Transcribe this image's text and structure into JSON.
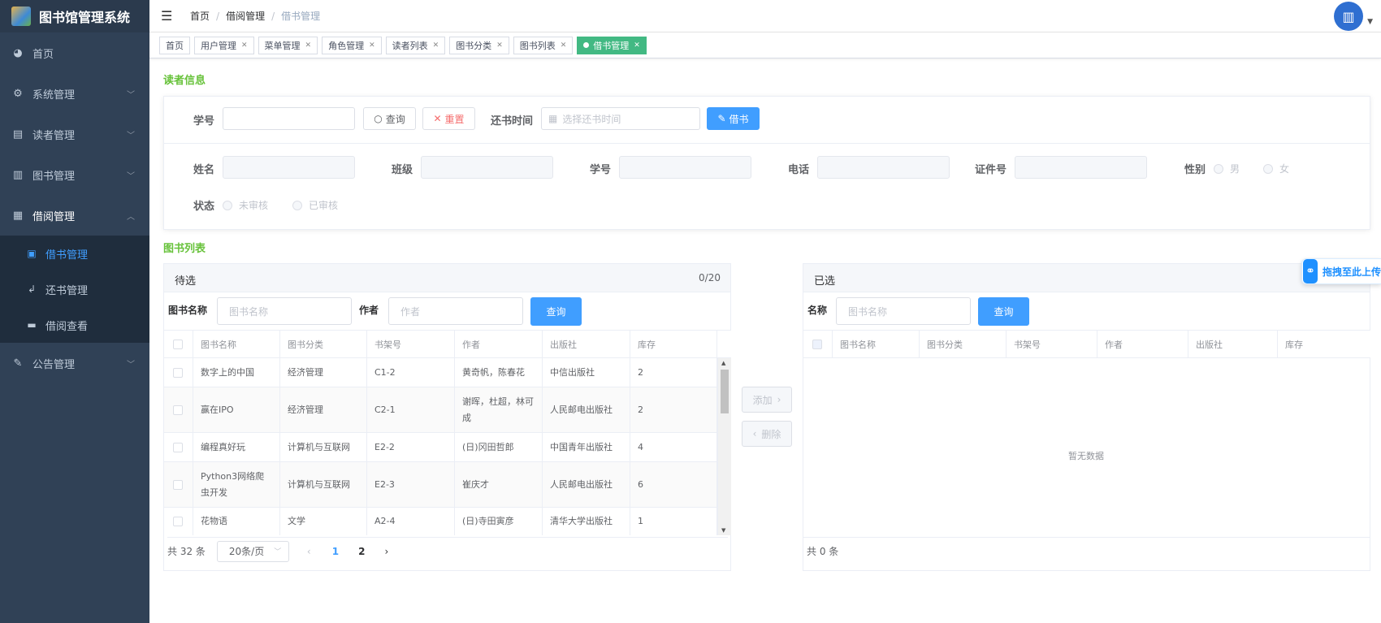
{
  "app": {
    "title": "图书馆管理系统"
  },
  "sidebar": {
    "items": [
      {
        "label": "首页",
        "icon": "dashboard-icon",
        "glyph": "◕"
      },
      {
        "label": "系统管理",
        "icon": "gear-icon",
        "glyph": "⚙"
      },
      {
        "label": "读者管理",
        "icon": "id-card-icon",
        "glyph": "▤"
      },
      {
        "label": "图书管理",
        "icon": "books-icon",
        "glyph": "▥"
      },
      {
        "label": "借阅管理",
        "icon": "document-icon",
        "glyph": "▦"
      },
      {
        "label": "公告管理",
        "icon": "megaphone-icon",
        "glyph": "✎"
      }
    ],
    "sub": [
      {
        "label": "借书管理",
        "icon": "book-icon",
        "glyph": "▣"
      },
      {
        "label": "还书管理",
        "icon": "return-icon",
        "glyph": "↲"
      },
      {
        "label": "借阅查看",
        "icon": "briefcase-icon",
        "glyph": "▬"
      }
    ]
  },
  "header": {
    "breadcrumb": [
      "首页",
      "借阅管理",
      "借书管理"
    ],
    "separator": "/"
  },
  "tags": [
    "首页",
    "用户管理",
    "菜单管理",
    "角色管理",
    "读者列表",
    "图书分类",
    "图书列表",
    "借书管理"
  ],
  "reader": {
    "title": "读者信息",
    "student_no_label": "学号",
    "query_label": "查询",
    "reset_label": "重置",
    "return_time_label": "还书时间",
    "return_time_placeholder": "选择还书时间",
    "borrow_label": "借书",
    "name_label": "姓名",
    "class_label": "班级",
    "student_no2_label": "学号",
    "phone_label": "电话",
    "id_label": "证件号",
    "gender_label": "性别",
    "male": "男",
    "female": "女",
    "status_label": "状态",
    "unreviewed": "未审核",
    "reviewed": "已审核"
  },
  "books": {
    "title": "图书列表",
    "left": {
      "title": "待选",
      "count": "0/20",
      "name_label": "图书名称",
      "name_placeholder": "图书名称",
      "author_label": "作者",
      "author_placeholder": "作者",
      "query_label": "查询",
      "columns": [
        "图书名称",
        "图书分类",
        "书架号",
        "作者",
        "出版社",
        "库存"
      ],
      "rows": [
        [
          "数字上的中国",
          "经济管理",
          "C1-2",
          "黄奇帆，陈春花",
          "中信出版社",
          "2"
        ],
        [
          "赢在IPO",
          "经济管理",
          "C2-1",
          "谢晖，杜超，林可成",
          "人民邮电出版社",
          "2"
        ],
        [
          "编程真好玩",
          "计算机与互联网",
          "E2-2",
          "(日)冈田哲郎",
          "中国青年出版社",
          "4"
        ],
        [
          "Python3网络爬虫开发",
          "计算机与互联网",
          "E2-3",
          "崔庆才",
          "人民邮电出版社",
          "6"
        ],
        [
          "花物语",
          "文学",
          "A2-4",
          "(日)寺田寅彦",
          "清华大学出版社",
          "1"
        ]
      ],
      "total": "共 32 条",
      "page_size": "20条/页",
      "pages": [
        "1",
        "2"
      ]
    },
    "add_label": "添加",
    "remove_label": "删除",
    "right": {
      "title": "已选",
      "name_label": "名称",
      "name_placeholder": "图书名称",
      "query_label": "查询",
      "columns": [
        "图书名称",
        "图书分类",
        "书架号",
        "作者",
        "出版社",
        "库存"
      ],
      "empty": "暂无数据",
      "total": "共 0 条"
    }
  },
  "float_upload": {
    "label": "拖拽至此上传"
  },
  "colors": {
    "sidebar": "#304156",
    "accent": "#409eff",
    "success": "#42b983",
    "section": "#67c23a"
  }
}
